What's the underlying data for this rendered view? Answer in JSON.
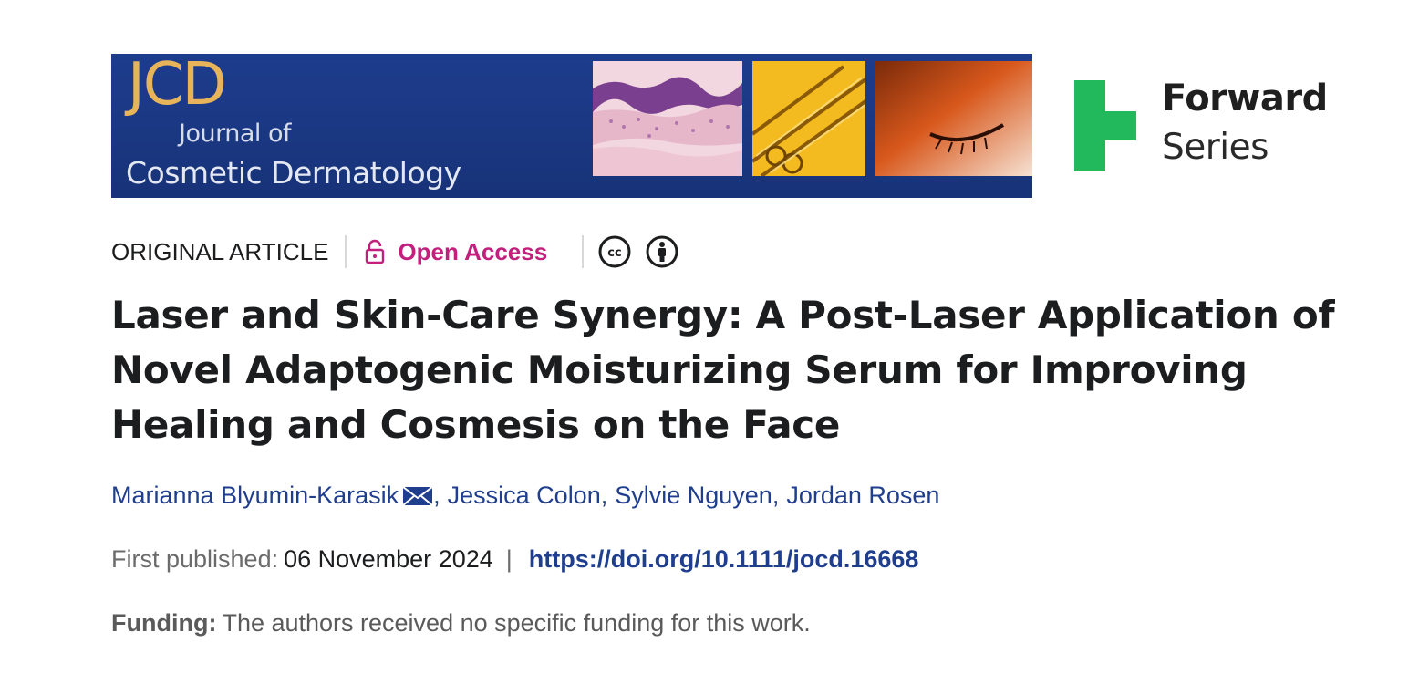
{
  "banner": {
    "mark": "JCD",
    "journal_of": "Journal of",
    "journal_name": "Cosmetic Dermatology"
  },
  "forward": {
    "title": "Forward",
    "subtitle": "Series",
    "logo_color": "#22b85c"
  },
  "meta": {
    "article_type": "ORIGINAL ARTICLE",
    "open_access_label": "Open Access",
    "open_access_color": "#c31f7c",
    "license_icons": [
      "creative-commons-icon",
      "attribution-icon"
    ]
  },
  "article": {
    "title": "Laser and Skin-Care Synergy: A Post-Laser Application of Novel Adaptogenic Moisturizing Serum for Improving Healing and Cosmesis on the Face"
  },
  "authors": [
    {
      "name": "Marianna Blyumin-Karasik",
      "corresponding": true
    },
    {
      "name": "Jessica Colon"
    },
    {
      "name": "Sylvie Nguyen"
    },
    {
      "name": "Jordan Rosen"
    }
  ],
  "published": {
    "label": "First published:",
    "date": "06 November 2024",
    "separator": "|",
    "doi": "https://doi.org/10.1111/jocd.16668"
  },
  "funding": {
    "label": "Funding:",
    "text": "The authors received no specific funding for this work."
  },
  "colors": {
    "link": "#1f3e8e",
    "banner_bg": "#1d3c8c",
    "banner_mark": "#e7b45a"
  }
}
